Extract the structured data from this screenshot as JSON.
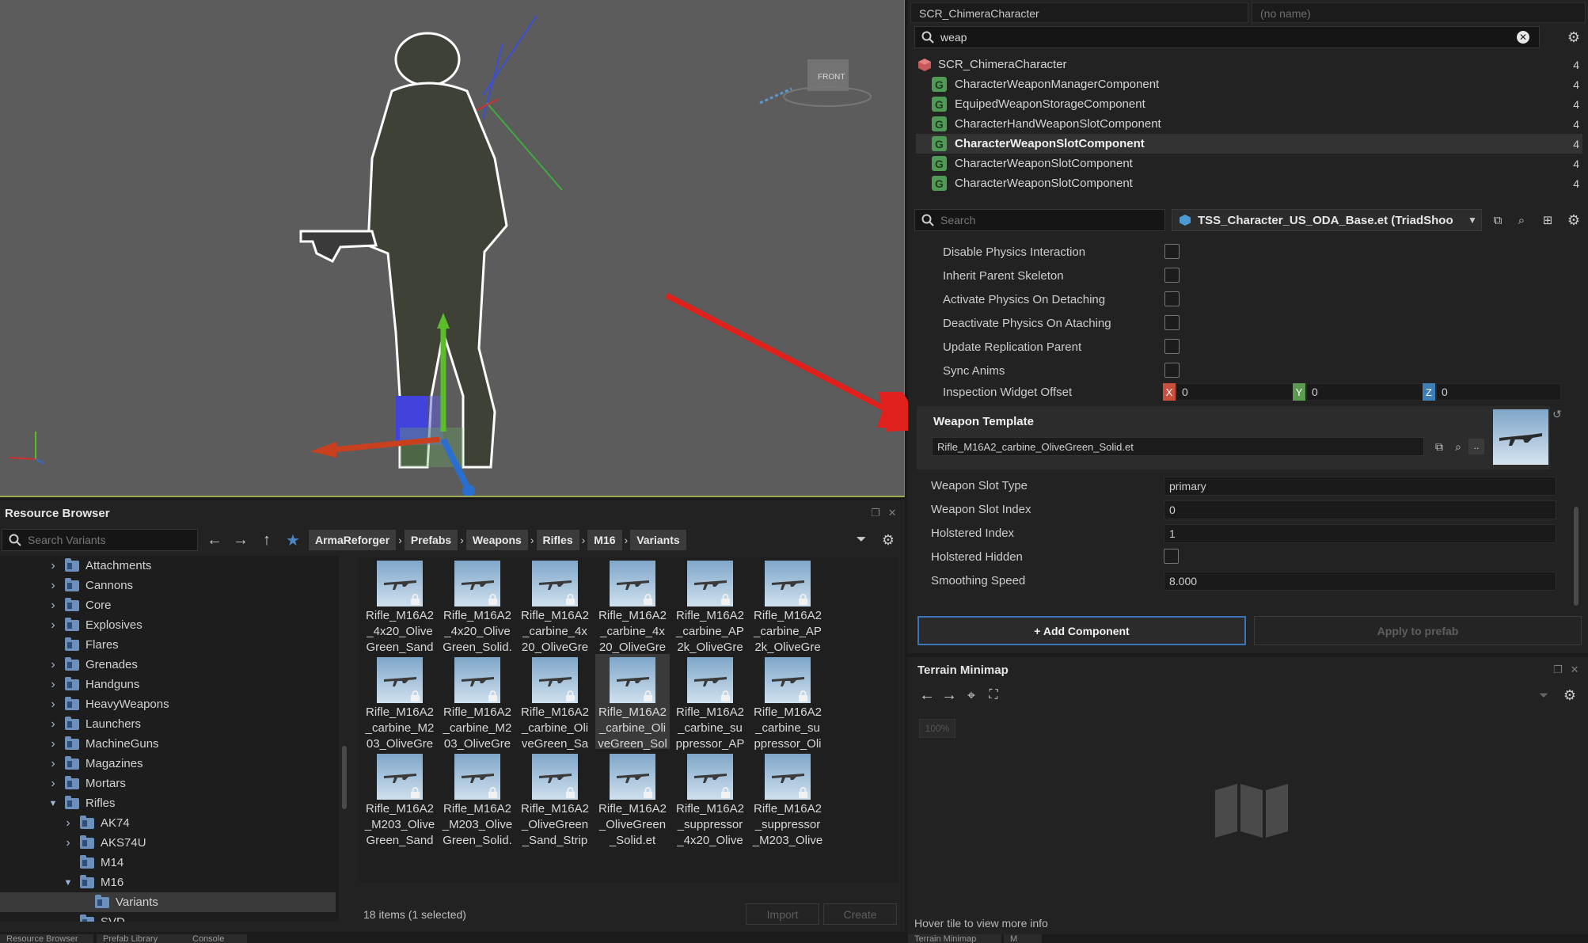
{
  "viewport": {
    "gizmo_label": "FRONT"
  },
  "resource_browser": {
    "title": "Resource Browser",
    "search_placeholder": "Search Variants",
    "breadcrumbs": [
      "ArmaReforger",
      "Prefabs",
      "Weapons",
      "Rifles",
      "M16",
      "Variants"
    ],
    "tree": [
      {
        "label": "Attachments",
        "level": 0,
        "expanded": false,
        "has_children": true
      },
      {
        "label": "Cannons",
        "level": 0,
        "expanded": false,
        "has_children": true
      },
      {
        "label": "Core",
        "level": 0,
        "expanded": false,
        "has_children": true
      },
      {
        "label": "Explosives",
        "level": 0,
        "expanded": false,
        "has_children": true
      },
      {
        "label": "Flares",
        "level": 0,
        "expanded": false,
        "has_children": false
      },
      {
        "label": "Grenades",
        "level": 0,
        "expanded": false,
        "has_children": true
      },
      {
        "label": "Handguns",
        "level": 0,
        "expanded": false,
        "has_children": true
      },
      {
        "label": "HeavyWeapons",
        "level": 0,
        "expanded": false,
        "has_children": true
      },
      {
        "label": "Launchers",
        "level": 0,
        "expanded": false,
        "has_children": true
      },
      {
        "label": "MachineGuns",
        "level": 0,
        "expanded": false,
        "has_children": true
      },
      {
        "label": "Magazines",
        "level": 0,
        "expanded": false,
        "has_children": true
      },
      {
        "label": "Mortars",
        "level": 0,
        "expanded": false,
        "has_children": true
      },
      {
        "label": "Rifles",
        "level": 0,
        "expanded": true,
        "has_children": true
      },
      {
        "label": "AK74",
        "level": 1,
        "expanded": false,
        "has_children": true
      },
      {
        "label": "AKS74U",
        "level": 1,
        "expanded": false,
        "has_children": true
      },
      {
        "label": "M14",
        "level": 1,
        "expanded": false,
        "has_children": false
      },
      {
        "label": "M16",
        "level": 1,
        "expanded": true,
        "has_children": true
      },
      {
        "label": "Variants",
        "level": 2,
        "expanded": false,
        "has_children": false,
        "selected": true
      },
      {
        "label": "SVD",
        "level": 1,
        "expanded": false,
        "has_children": false
      }
    ],
    "assets": [
      "Rifle_M16A2_4x20_OliveGreen_Sand_",
      "Rifle_M16A2_4x20_OliveGreen_Solid.",
      "Rifle_M16A2_carbine_4x20_OliveGree",
      "Rifle_M16A2_carbine_4x20_OliveGree",
      "Rifle_M16A2_carbine_AP2k_OliveGre",
      "Rifle_M16A2_carbine_AP2k_OliveGre",
      "Rifle_M16A2_carbine_M203_OliveGre",
      "Rifle_M16A2_carbine_M203_OliveGre",
      "Rifle_M16A2_carbine_OliveGreen_San",
      "Rifle_M16A2_carbine_OliveGreen_Soli",
      "Rifle_M16A2_carbine_suppressor_AP2",
      "Rifle_M16A2_carbine_suppressor_Oliv",
      "Rifle_M16A2_M203_OliveGreen_Sand_",
      "Rifle_M16A2_M203_OliveGreen_Solid.",
      "Rifle_M16A2_OliveGreen_Sand_Stripe",
      "Rifle_M16A2_OliveGreen_Solid.et",
      "Rifle_M16A2_suppressor_4x20_OliveG",
      "Rifle_M16A2_suppressor_M203_Olive"
    ],
    "selected_asset_index": 9,
    "status": "18 items (1 selected)",
    "import_label": "Import",
    "create_label": "Create"
  },
  "bottom_tabs": [
    "Resource Browser",
    "Prefab Library",
    "Console",
    "Terrain Minimap",
    "M"
  ],
  "entity_panel": {
    "class_name": "SCR_ChimeraCharacter",
    "entity_name_placeholder": "(no name)",
    "filter_value": "weap",
    "root": {
      "label": "SCR_ChimeraCharacter",
      "count": "4"
    },
    "components": [
      {
        "label": "CharacterWeaponManagerComponent",
        "count": "4"
      },
      {
        "label": "EquipedWeaponStorageComponent",
        "count": "4"
      },
      {
        "label": "CharacterHandWeaponSlotComponent",
        "count": "4"
      },
      {
        "label": "CharacterWeaponSlotComponent",
        "count": "4",
        "selected": true
      },
      {
        "label": "CharacterWeaponSlotComponent",
        "count": "4"
      },
      {
        "label": "CharacterWeaponSlotComponent",
        "count": "4"
      }
    ],
    "prop_search_placeholder": "Search",
    "prefab_name": "TSS_Character_US_ODA_Base.et (TriadShoo",
    "properties_top": [
      {
        "label": "Disable Physics Interaction"
      },
      {
        "label": "Inherit Parent Skeleton"
      },
      {
        "label": "Activate Physics On Detaching"
      },
      {
        "label": "Deactivate Physics On Ataching"
      },
      {
        "label": "Update Replication Parent"
      },
      {
        "label": "Sync Anims"
      }
    ],
    "inspection_offset": {
      "label": "Inspection Widget Offset",
      "x": "0",
      "y": "0",
      "z": "0",
      "x_label": "X",
      "y_label": "Y",
      "z_label": "Z"
    },
    "weapon_template": {
      "label": "Weapon Template",
      "value": "Rifle_M16A2_carbine_OliveGreen_Solid.et",
      "more": ".."
    },
    "properties_bottom": [
      {
        "label": "Weapon Slot Type",
        "value": "primary",
        "type": "text"
      },
      {
        "label": "Weapon Slot Index",
        "value": "0",
        "type": "text"
      },
      {
        "label": "Holstered Index",
        "value": "1",
        "type": "text"
      },
      {
        "label": "Holstered Hidden",
        "value": "",
        "type": "checkbox"
      },
      {
        "label": "Smoothing Speed",
        "value": "8.000",
        "type": "text"
      }
    ],
    "add_component_label": "+ Add Component",
    "apply_prefab_label": "Apply to prefab"
  },
  "terrain_minimap": {
    "title": "Terrain Minimap",
    "zoom": "100%",
    "status": "Hover tile to view more info"
  },
  "colors": {
    "accent_blue": "#3c74b8",
    "component_green": "#4f9a55",
    "arrow_red": "#e0201b",
    "axis_x": "#c8503c",
    "axis_y": "#5c9a52",
    "axis_z": "#3f7fb8"
  }
}
